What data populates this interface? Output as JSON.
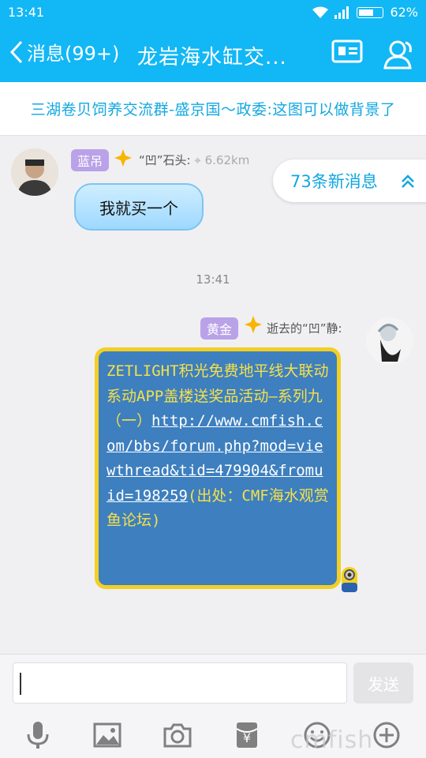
{
  "status_bar": {
    "time": "13:41",
    "battery": "62%"
  },
  "nav": {
    "back_label": "消息(99+)",
    "title": "龙岩海水缸交..."
  },
  "notice": "三湖卷贝饲养交流群-盛京国～政委:这图可以做背景了",
  "message1": {
    "badge": "蓝吊",
    "sender": "“凹”石头:",
    "distance": "6.62km",
    "text": "我就买一个"
  },
  "new_messages": "73条新消息",
  "timestamp": "13:41",
  "message2": {
    "badge": "黄金",
    "sender": "逝去的“凹”静:",
    "line1": "ZETLIGHT积光免费地平线大联动系动APP盖楼送奖品活动—系列九（一）",
    "link": "http://www.cmfish.com/bbs/forum.php?mod=viewthread&tid=479904&fromuid=198259",
    "source": "(出处：CMF海水观赏鱼论坛)"
  },
  "input": {
    "placeholder": "",
    "send_label": "发送"
  },
  "toolbar": [
    "microphone-icon",
    "image-icon",
    "camera-icon",
    "red-packet-icon",
    "emoji-icon",
    "plus-icon"
  ],
  "watermark": "cmfish",
  "colors": {
    "accent": "#12b7f5",
    "bubble_yellow_border": "#f2cf24",
    "bubble_blue": "#3d7fbf"
  }
}
